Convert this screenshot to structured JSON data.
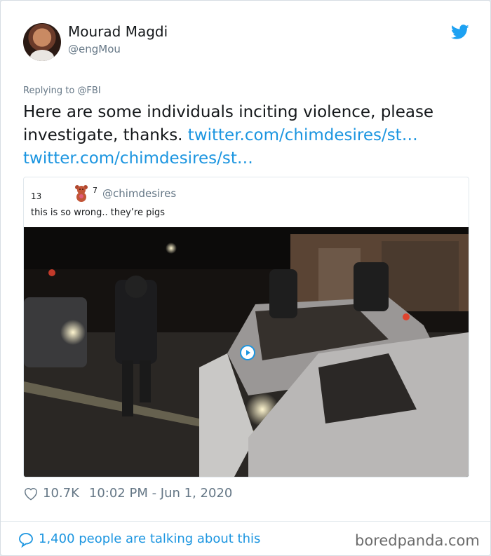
{
  "author": {
    "name": "Mourad Magdi",
    "handle": "@engMou"
  },
  "reply": {
    "text": "Replying to @FBI"
  },
  "tweet": {
    "text": "Here are some individuals inciting violence, please investigate, thanks. ",
    "link1": "twitter.com/chimdesires/st…",
    "link2": "twitter.com/chimdesires/st…"
  },
  "quote": {
    "count": "13",
    "superscript": "7",
    "handle": "@chimdesires",
    "text": "this is so wrong.. they’re pigs"
  },
  "meta": {
    "likes": "10.7K",
    "datetime": "10:02 PM - Jun 1, 2020"
  },
  "footer": {
    "talking": "1,400 people are talking about this",
    "watermark": "boredpanda.com"
  },
  "colors": {
    "link": "#1b95e0",
    "muted": "#657786",
    "text": "#14171a"
  },
  "icons": [
    "twitter-bird-icon",
    "teddy-bear-emoji-icon",
    "play-icon",
    "heart-icon",
    "speech-bubble-icon"
  ]
}
